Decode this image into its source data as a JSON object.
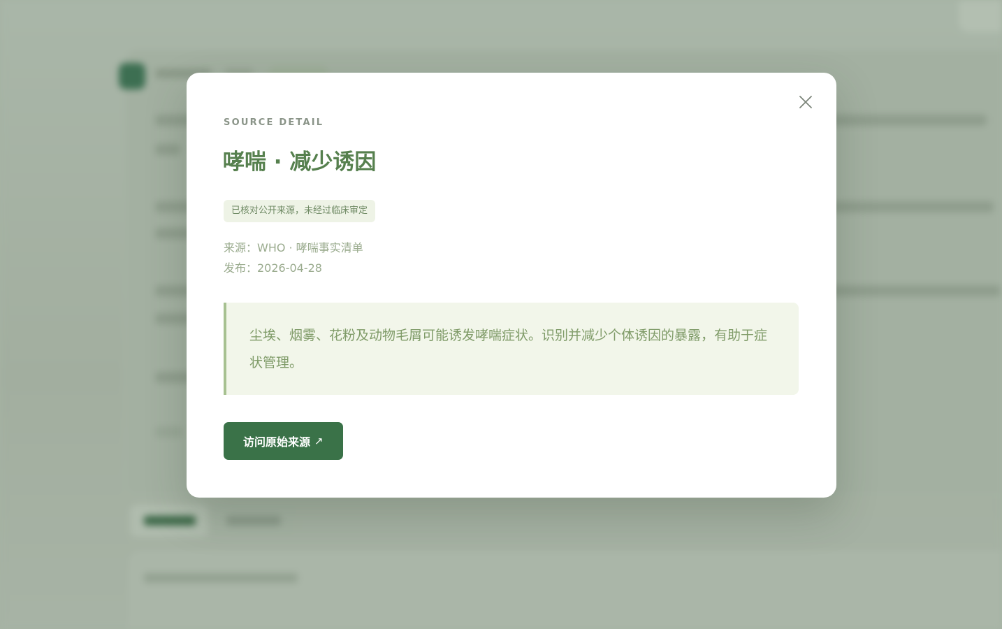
{
  "modal": {
    "eyebrow": "SOURCE DETAIL",
    "title": "哮喘 · 减少诱因",
    "badge": "已核对公开来源，未经过临床审定",
    "source_line": "来源：WHO · 哮喘事实清单",
    "published_line": "发布：2026-04-28",
    "quote": "尘埃、烟雾、花粉及动物毛屑可能诱发哮喘症状。识别并减少个体诱因的暴露，有助于症状管理。",
    "visit_label": "访问原始来源",
    "visit_icon": "↗",
    "close_icon": "close-icon"
  },
  "colors": {
    "accent": "#3a7248",
    "title": "#56804e",
    "quote_bg": "#f2f6ea",
    "quote_border": "#a7c191"
  }
}
